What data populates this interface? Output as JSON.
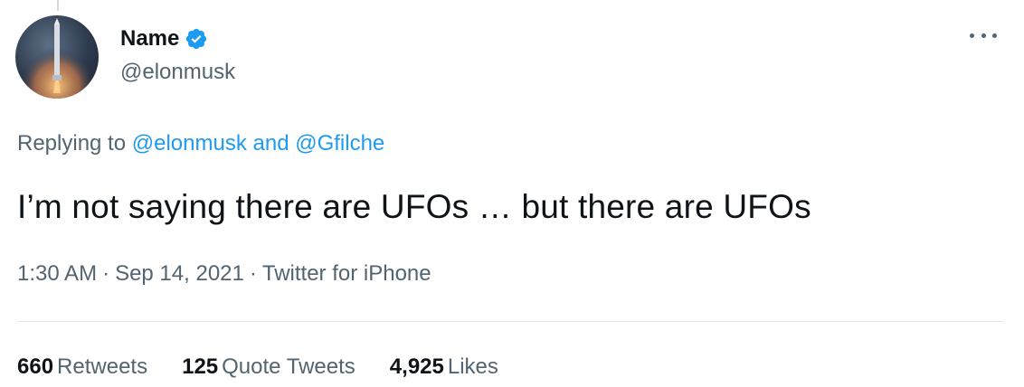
{
  "author": {
    "display_name": "Name",
    "handle": "@elonmusk",
    "verified": true,
    "avatar_icon": "rocket-avatar-icon"
  },
  "reply": {
    "prefix": "Replying to",
    "mention1": "@elonmusk",
    "conjunction": "and",
    "mention2": "@Gfilche"
  },
  "tweet": {
    "text": "I’m not saying there are UFOs … but there are UFOs"
  },
  "meta": {
    "time": "1:30 AM",
    "date": "Sep 14, 2021",
    "source": "Twitter for iPhone",
    "separator": "·"
  },
  "stats": {
    "retweets_count": "660",
    "retweets_label": "Retweets",
    "quotes_count": "125",
    "quotes_label": "Quote Tweets",
    "likes_count": "4,925",
    "likes_label": "Likes"
  },
  "colors": {
    "link": "#1d9bf0",
    "secondary_text": "#536471",
    "primary_text": "#0f1419",
    "verified_badge": "#1d9bf0"
  }
}
